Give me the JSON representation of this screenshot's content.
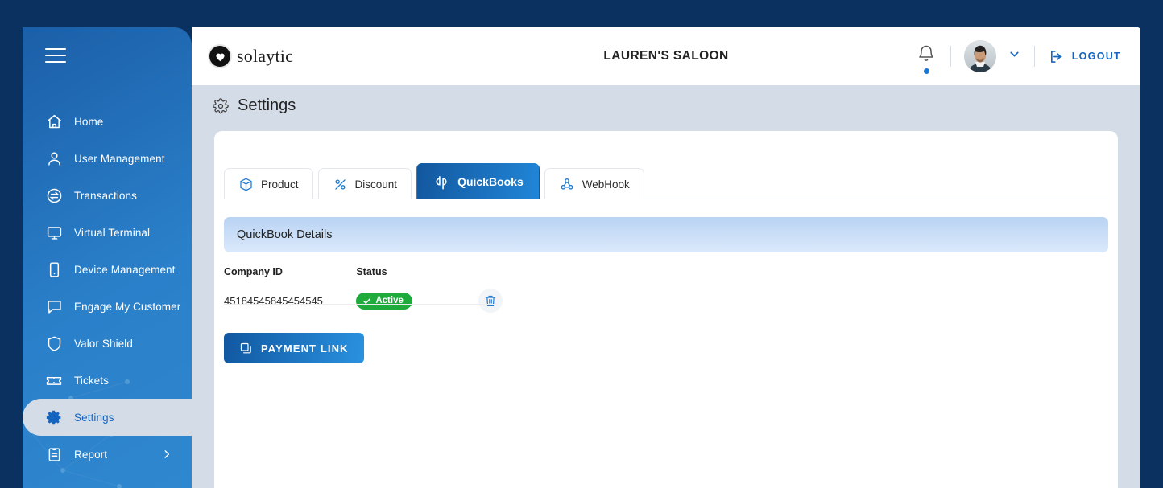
{
  "colors": {
    "frame": "#0b3160",
    "sidebar_gradient_start": "#1b5fa8",
    "sidebar_gradient_end": "#2f88cf",
    "page_bg": "#d4dce8",
    "accent_blue": "#1565c0",
    "active_tab_gradient_start": "#12579e",
    "active_tab_gradient_end": "#2186d8",
    "status_green": "#1faa3c",
    "banner_gradient_start": "#b9d3f3",
    "banner_gradient_end": "#dbe9fb"
  },
  "sidebar": {
    "menu_icon": "hamburger-icon",
    "items": [
      {
        "label": "Home",
        "icon": "home-icon",
        "active": false,
        "has_chevron": false
      },
      {
        "label": "User Management",
        "icon": "user-icon",
        "active": false,
        "has_chevron": false
      },
      {
        "label": "Transactions",
        "icon": "transactions-icon",
        "active": false,
        "has_chevron": false
      },
      {
        "label": "Virtual Terminal",
        "icon": "monitor-icon",
        "active": false,
        "has_chevron": false
      },
      {
        "label": "Device Management",
        "icon": "device-icon",
        "active": false,
        "has_chevron": false
      },
      {
        "label": "Engage My Customer",
        "icon": "chat-icon",
        "active": false,
        "has_chevron": false
      },
      {
        "label": "Valor Shield",
        "icon": "shield-icon",
        "active": false,
        "has_chevron": false
      },
      {
        "label": "Tickets",
        "icon": "ticket-icon",
        "active": false,
        "has_chevron": false
      },
      {
        "label": "Settings",
        "icon": "gear-icon",
        "active": true,
        "has_chevron": false
      },
      {
        "label": "Report",
        "icon": "report-icon",
        "active": false,
        "has_chevron": true
      }
    ]
  },
  "header": {
    "brand_name": "solaytic",
    "brand_icon": "heart-logo-icon",
    "store_title": "LAUREN'S SALOON",
    "bell_icon": "notification-bell-icon",
    "has_notification": true,
    "avatar_icon": "user-avatar",
    "chevron_icon": "chevron-down-icon",
    "logout_icon": "logout-icon",
    "logout_label": "LOGOUT"
  },
  "page": {
    "title": "Settings",
    "title_icon": "gear-icon"
  },
  "tabs": [
    {
      "label": "Product",
      "icon": "box-icon",
      "active": false
    },
    {
      "label": "Discount",
      "icon": "percent-icon",
      "active": false
    },
    {
      "label": "QuickBooks",
      "icon": "quickbooks-icon",
      "active": true
    },
    {
      "label": "WebHook",
      "icon": "webhook-icon",
      "active": false
    }
  ],
  "panel": {
    "banner_title": "QuickBook Details",
    "table": {
      "headers": [
        "Company ID",
        "Status"
      ],
      "rows": [
        {
          "company_id": "45184545845454545",
          "status": "Active",
          "status_icon": "check-icon",
          "delete_icon": "trash-icon"
        }
      ]
    },
    "payment_link_button": {
      "label": "PAYMENT LINK",
      "icon": "copy-icon"
    }
  }
}
